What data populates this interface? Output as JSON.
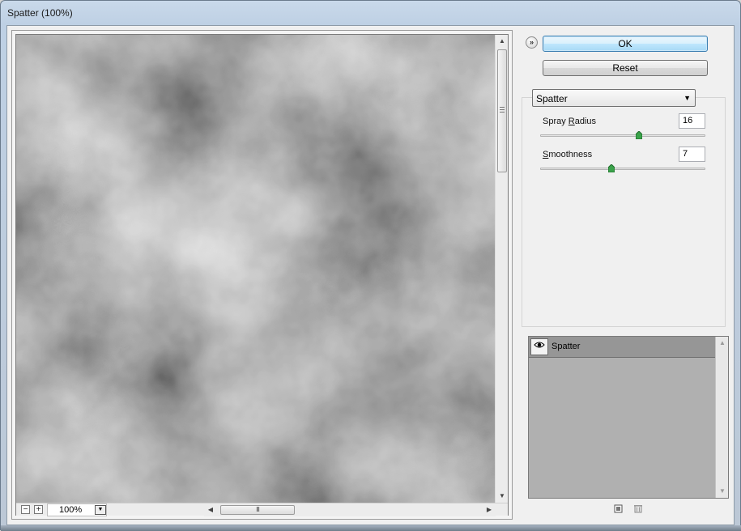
{
  "window": {
    "title": "Spatter (100%)"
  },
  "preview": {
    "zoom_out_symbol": "−",
    "zoom_in_symbol": "+",
    "zoom_value": "100%",
    "zoom_dropdown_icon": "chevron-down-icon",
    "hscroll_grip": "III",
    "scroll_up_icon": "arrow-up-icon",
    "scroll_down_icon": "arrow-down-icon",
    "scroll_left_icon": "arrow-left-icon",
    "scroll_right_icon": "arrow-right-icon"
  },
  "buttons": {
    "collapse_icon": "double-chevron-down-icon",
    "ok_label": "OK",
    "reset_label": "Reset"
  },
  "filter": {
    "selected": "Spatter",
    "params": [
      {
        "label_prefix": "Spray ",
        "label_underlined": "R",
        "label_rest": "adius",
        "value": "16",
        "slider_level": 0.6
      },
      {
        "label_prefix": "",
        "label_underlined": "S",
        "label_rest": "moothness",
        "value": "7",
        "slider_level": 0.43
      }
    ]
  },
  "layers": {
    "items": [
      {
        "name": "Spatter",
        "visible_icon": "eye-icon"
      }
    ],
    "new_layer_icon": "new-effect-layer-icon",
    "delete_icon": "trash-icon"
  },
  "colors": {
    "ok_button_border": "#3c7fb1",
    "slider_thumb": "#3aa24a",
    "layers_background": "#b0b0b0",
    "selected_layer": "#969696"
  }
}
